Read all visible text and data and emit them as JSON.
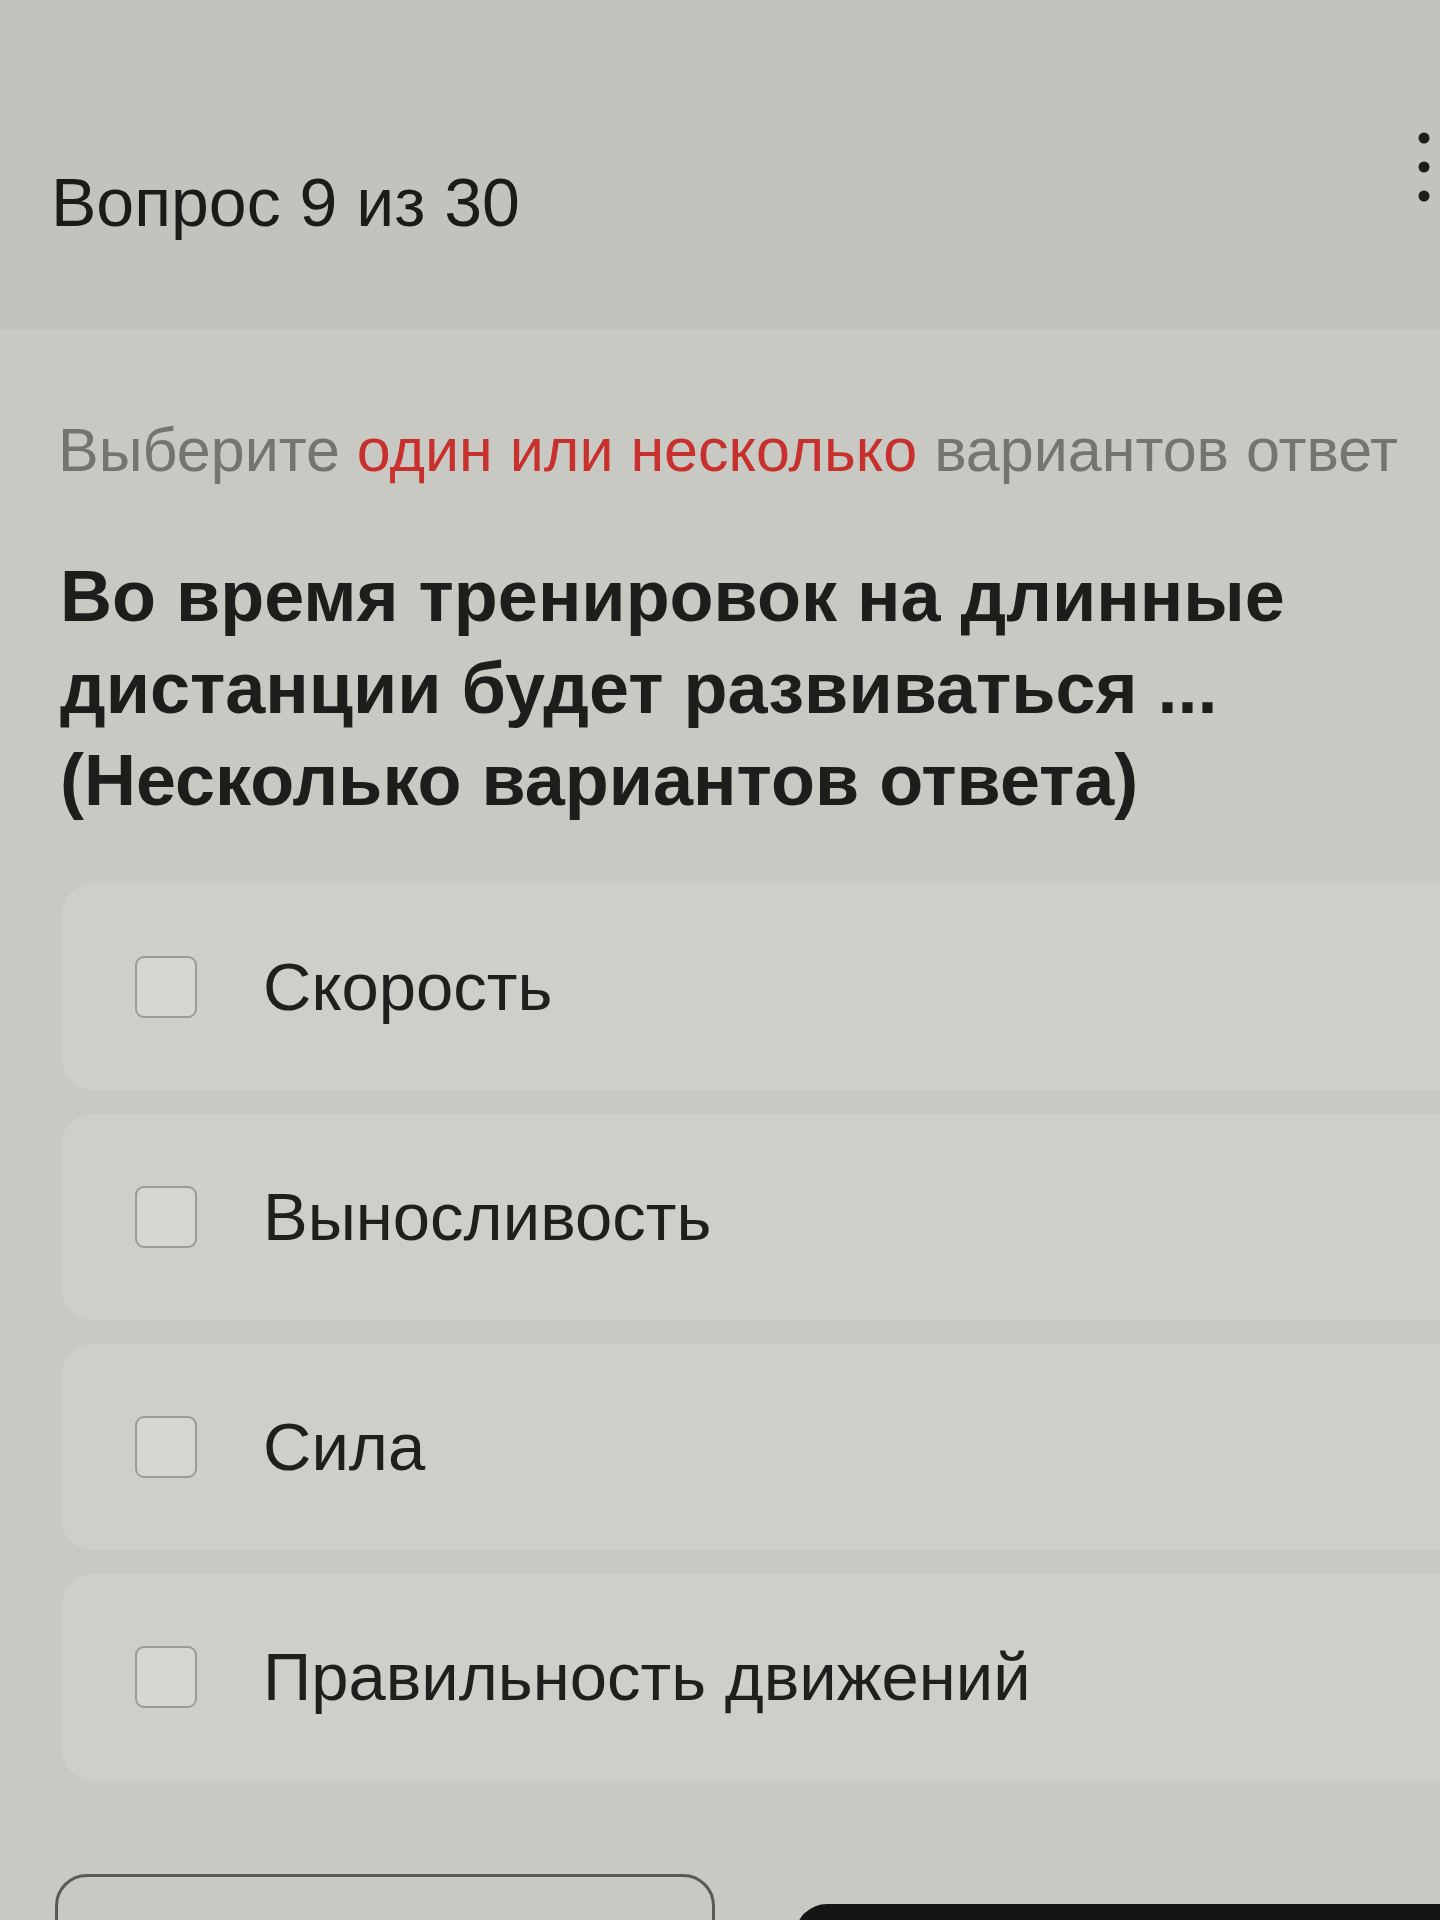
{
  "header": {
    "title": "Вопрос 9 из 30"
  },
  "instruction": {
    "before": "Выберите",
    "highlight": "один или несколько",
    "after": "вариантов ответ"
  },
  "question": {
    "text": "Во время тренировок на длинные дистанции будет развиваться ... (Несколько вариантов ответа)"
  },
  "options": [
    {
      "label": "Скорость",
      "checked": false
    },
    {
      "label": "Выносливость",
      "checked": false
    },
    {
      "label": "Сила",
      "checked": false
    },
    {
      "label": "Правильность движений",
      "checked": false
    }
  ],
  "footer_buttons": [
    {
      "kind": "outline"
    },
    {
      "kind": "filled"
    }
  ]
}
